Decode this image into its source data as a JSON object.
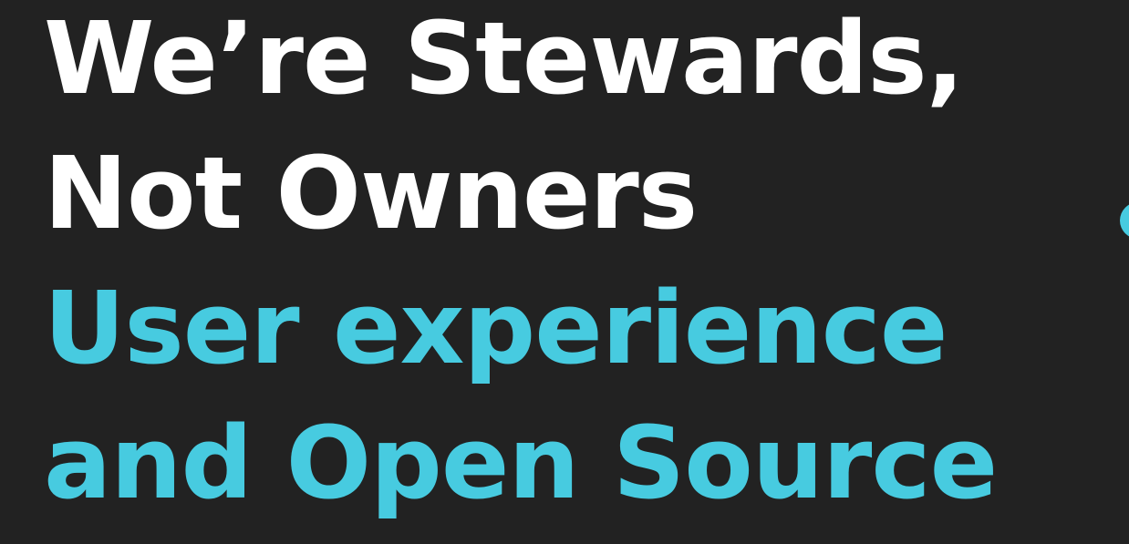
{
  "slide": {
    "title_lines": [
      "We’re Stewards,",
      "Not Owners"
    ],
    "subtitle_lines": [
      "User experience",
      "and Open Source"
    ]
  },
  "colors": {
    "background": "#222222",
    "title": "#ffffff",
    "accent": "#47cbe0"
  }
}
